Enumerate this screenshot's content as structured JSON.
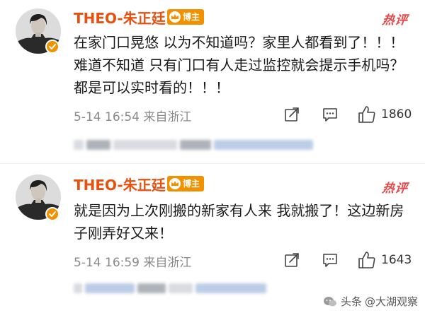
{
  "colors": {
    "username": "#e8500f",
    "badge": "#f29100",
    "hot": "#e64545",
    "meta": "#8a8a8a",
    "text": "#1a1a1a"
  },
  "posts": [
    {
      "username": "THEO-朱正廷",
      "badge_label": "博主",
      "badge_icon": "crown-icon",
      "hot_label": "热评",
      "content": "在家门口晃悠 以为不知道吗？家里人都看到了！！！  难道不知道 只有门口有人走过监控就会提示手机吗？都是可以实时看的！！！",
      "date": "5-14",
      "time": "16:54",
      "location": "来自浙江",
      "likes": "1860"
    },
    {
      "username": "THEO-朱正廷",
      "badge_label": "博主",
      "badge_icon": "crown-icon",
      "hot_label": "热评",
      "content": "就是因为上次刚搬的新家有人来 我就搬了！这边新房子刚弄好又来！",
      "date": "5-14",
      "time": "16:59",
      "location": "来自浙江",
      "likes": "1643"
    }
  ],
  "watermark": {
    "prefix": "头条",
    "handle": "@大湖观察"
  }
}
